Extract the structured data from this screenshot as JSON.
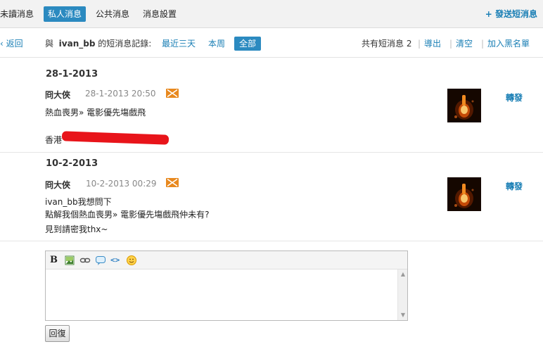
{
  "tabs": [
    {
      "label": "未讀消息",
      "active": false
    },
    {
      "label": "私人消息",
      "active": true
    },
    {
      "label": "公共消息",
      "active": false
    },
    {
      "label": "消息設置",
      "active": false
    }
  ],
  "send_new_label": "+ 發送短消息",
  "filter": {
    "back_label": "返回",
    "with_label": "與",
    "partner": "ivan_bb",
    "history_label": "的短消息記錄:",
    "options": [
      {
        "label": "最近三天",
        "active": false
      },
      {
        "label": "本周",
        "active": false
      },
      {
        "label": "全部",
        "active": true
      }
    ],
    "total_label": "共有短消息",
    "total_count": "2",
    "sep": "|",
    "export_label": "導出",
    "clear_label": "清空",
    "blacklist_label": "加入黑名單"
  },
  "threads": [
    {
      "date": "28-1-2013",
      "user": "冏大俠",
      "time": "28-1-2013 20:50",
      "lines": [
        "熱血喪男» 電影優先塲戲飛",
        "",
        "香港"
      ],
      "forward_label": "轉發"
    },
    {
      "date": "10-2-2013",
      "user": "冏大俠",
      "time": "10-2-2013 00:29",
      "lines": [
        "ivan_bb我想問下",
        "點解我個熱血喪男» 電影優先塲戲飛仲未有?",
        "見到請密我thx~"
      ],
      "forward_label": "轉發"
    }
  ],
  "editor": {
    "bold_label": "B",
    "tools": [
      "bold-icon",
      "image-icon",
      "link-icon",
      "quote-icon",
      "code-icon",
      "smiley-icon"
    ],
    "text": ""
  },
  "reply_label": "回復",
  "colors": {
    "accent": "#2b8ac0",
    "link": "#1a7fb5",
    "mail": "#e8891f",
    "redaction": "#e8141a"
  }
}
